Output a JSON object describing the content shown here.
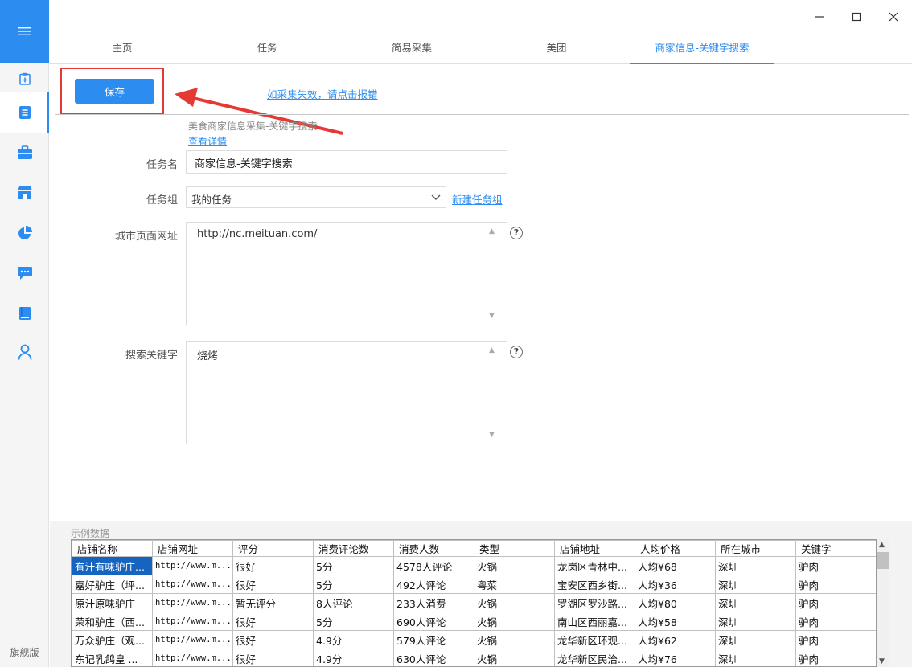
{
  "sidebar": {
    "edition": "旗舰版",
    "items": [
      {
        "icon": "clipboard-plus-icon"
      },
      {
        "icon": "document-list-icon"
      },
      {
        "icon": "briefcase-icon"
      },
      {
        "icon": "store-icon"
      },
      {
        "icon": "pie-chart-icon"
      },
      {
        "icon": "chat-bubble-icon"
      },
      {
        "icon": "book-icon"
      },
      {
        "icon": "user-icon"
      }
    ]
  },
  "tabs": [
    {
      "label": "主页"
    },
    {
      "label": "任务"
    },
    {
      "label": "简易采集"
    },
    {
      "label": "美团"
    },
    {
      "label": "商家信息-关键字搜索"
    }
  ],
  "toolbar": {
    "save_label": "保存",
    "report_link": "如采集失效，请点击报错"
  },
  "form": {
    "description": "美食商家信息采集-关键字搜索",
    "detail_link": "查看详情",
    "task_name_label": "任务名",
    "task_name_value": "商家信息-关键字搜索",
    "task_group_label": "任务组",
    "task_group_value": "我的任务",
    "new_group_link": "新建任务组",
    "city_url_label": "城市页面网址",
    "city_url_value": "http://nc.meituan.com/",
    "keyword_label": "搜索关键字",
    "keyword_value": "烧烤"
  },
  "sample": {
    "label": "示例数据",
    "columns": [
      "店铺名称",
      "店铺网址",
      "评分",
      "消费评论数",
      "消费人数",
      "类型",
      "店铺地址",
      "人均价格",
      "所在城市",
      "关键字"
    ],
    "rows": [
      [
        "有汁有味驴庄...",
        "http://www.m...",
        "很好",
        "5分",
        "4578人评论",
        "火锅",
        "龙岗区青林中...",
        "人均¥68",
        "深圳",
        "驴肉"
      ],
      [
        "嘉好驴庄（坪...",
        "http://www.m...",
        "很好",
        "5分",
        "492人评论",
        "粤菜",
        "宝安区西乡街...",
        "人均¥36",
        "深圳",
        "驴肉"
      ],
      [
        "原汁原味驴庄",
        "http://www.m...",
        "暂无评分",
        "8人评论",
        "233人消费",
        "火锅",
        "罗湖区罗沙路...",
        "人均¥80",
        "深圳",
        "驴肉"
      ],
      [
        "荣和驴庄（西...",
        "http://www.m...",
        "很好",
        "5分",
        "690人评论",
        "火锅",
        "南山区西丽嘉...",
        "人均¥58",
        "深圳",
        "驴肉"
      ],
      [
        "万众驴庄（观...",
        "http://www.m...",
        "很好",
        "4.9分",
        "579人评论",
        "火锅",
        "龙华新区环观...",
        "人均¥62",
        "深圳",
        "驴肉"
      ],
      [
        "东记乳鸽皇 ...",
        "http://www.m...",
        "很好",
        "4.9分",
        "630人评论",
        "火锅",
        "龙华新区民治...",
        "人均¥76",
        "深圳",
        "驴肉"
      ]
    ]
  },
  "colors": {
    "accent": "#2d8cf0",
    "highlight": "#e53935"
  }
}
